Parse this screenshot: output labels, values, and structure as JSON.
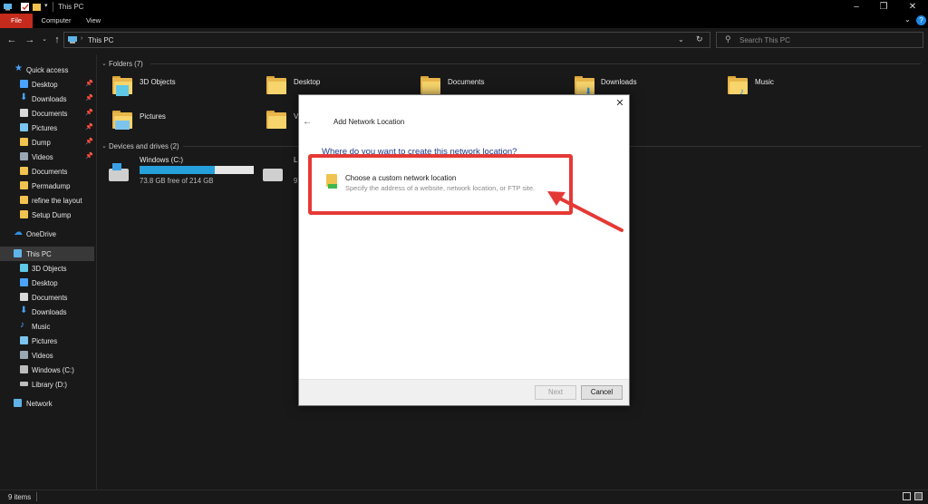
{
  "window": {
    "title": "This PC"
  },
  "ribbon": {
    "tabs": [
      "File",
      "Computer",
      "View"
    ]
  },
  "address": {
    "path": "This PC",
    "search_placeholder": "Search This PC"
  },
  "sidebar": {
    "items": [
      {
        "label": "Quick access",
        "icon": "star-icon",
        "pinned": false
      },
      {
        "label": "Desktop",
        "icon": "desktop-icon",
        "pinned": true
      },
      {
        "label": "Downloads",
        "icon": "download-icon",
        "pinned": true
      },
      {
        "label": "Documents",
        "icon": "documents-icon",
        "pinned": true
      },
      {
        "label": "Pictures",
        "icon": "pictures-icon",
        "pinned": true
      },
      {
        "label": "Dump",
        "icon": "folder-icon",
        "pinned": true
      },
      {
        "label": "Videos",
        "icon": "videos-icon",
        "pinned": true
      },
      {
        "label": "Documents",
        "icon": "folder-icon",
        "pinned": false
      },
      {
        "label": "Permadump",
        "icon": "folder-icon",
        "pinned": false
      },
      {
        "label": "refine the layout",
        "icon": "folder-icon",
        "pinned": false
      },
      {
        "label": "Setup Dump",
        "icon": "folder-icon",
        "pinned": false
      },
      {
        "label": "OneDrive",
        "icon": "cloud-icon",
        "pinned": false
      },
      {
        "label": "This PC",
        "icon": "computer-icon",
        "pinned": false
      },
      {
        "label": "3D Objects",
        "icon": "cube-icon",
        "pinned": false
      },
      {
        "label": "Desktop",
        "icon": "desktop-icon",
        "pinned": false
      },
      {
        "label": "Documents",
        "icon": "documents-icon",
        "pinned": false
      },
      {
        "label": "Downloads",
        "icon": "download-icon",
        "pinned": false
      },
      {
        "label": "Music",
        "icon": "music-icon",
        "pinned": false
      },
      {
        "label": "Pictures",
        "icon": "pictures-icon",
        "pinned": false
      },
      {
        "label": "Videos",
        "icon": "videos-icon",
        "pinned": false
      },
      {
        "label": "Windows (C:)",
        "icon": "drive-icon",
        "pinned": false
      },
      {
        "label": "Library (D:)",
        "icon": "drive-icon",
        "pinned": false
      },
      {
        "label": "Network",
        "icon": "network-icon",
        "pinned": false
      }
    ]
  },
  "content": {
    "folders_header": "Folders (7)",
    "folders": [
      "3D Objects",
      "Desktop",
      "Documents",
      "Downloads",
      "Music",
      "Pictures",
      "V"
    ],
    "drives_header": "Devices and drives (2)",
    "drives": [
      {
        "name": "Windows (C:)",
        "info": "73.8 GB free of 214 GB",
        "used_fraction": 0.66
      },
      {
        "name": "L",
        "info": "9",
        "used_fraction": 0
      }
    ]
  },
  "status": {
    "items": "9 items"
  },
  "dialog": {
    "title": "Add Network Location",
    "question": "Where do you want to create this network location?",
    "option_title": "Choose a custom network location",
    "option_desc": "Specify the address of a website, network location, or FTP site.",
    "next_label": "Next",
    "cancel_label": "Cancel"
  },
  "colors": {
    "accent": "#26a0da",
    "file_tab": "#c42b1c",
    "highlight": "#e53935"
  }
}
